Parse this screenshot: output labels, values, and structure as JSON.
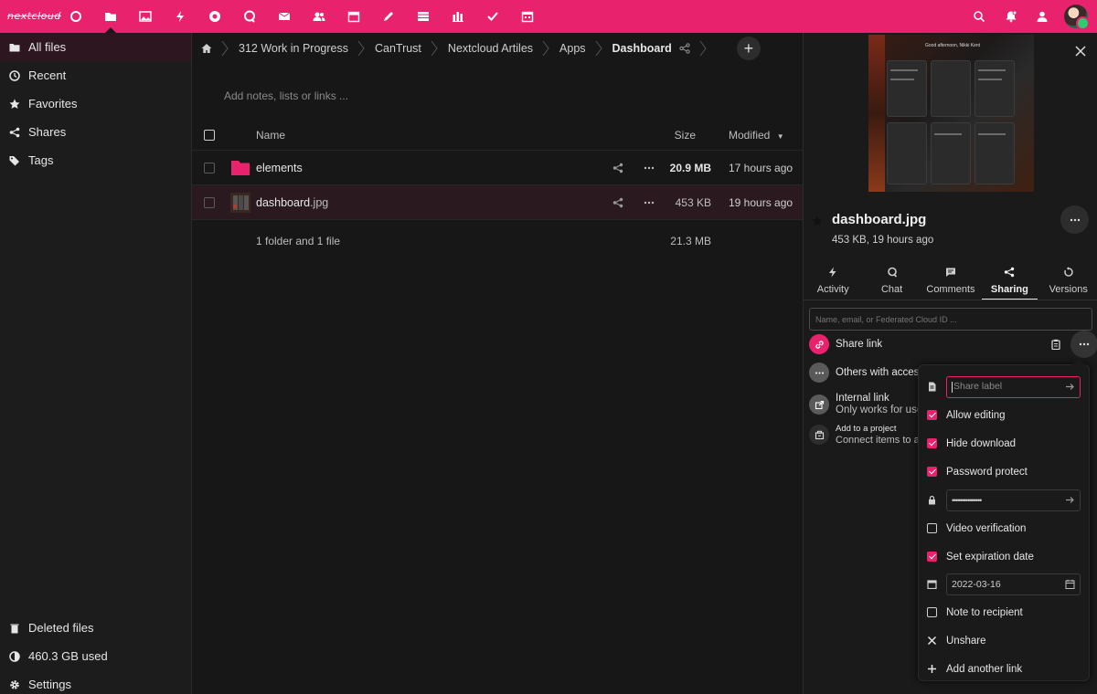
{
  "topbar": {
    "logo": "nextcloud",
    "apps": [
      "dashboard-icon",
      "files-icon",
      "photos-icon",
      "activity-icon",
      "circles-icon",
      "talk-icon",
      "mail-icon",
      "contacts-icon",
      "calendar-icon",
      "notes-icon",
      "deck-icon",
      "analytics-icon",
      "tasks-icon",
      "calendar-alt-icon"
    ],
    "right_icons": [
      "search-icon",
      "notifications-icon",
      "contacts-menu-icon"
    ]
  },
  "sidebar": {
    "items": [
      {
        "label": "All files",
        "icon": "folder-icon"
      },
      {
        "label": "Recent",
        "icon": "clock-icon"
      },
      {
        "label": "Favorites",
        "icon": "star-icon"
      },
      {
        "label": "Shares",
        "icon": "share-icon"
      },
      {
        "label": "Tags",
        "icon": "tag-icon"
      }
    ],
    "bottom": [
      {
        "label": "Deleted files",
        "icon": "trash-icon"
      },
      {
        "label": "460.3 GB used",
        "icon": "quota-icon"
      },
      {
        "label": "Settings",
        "icon": "gear-icon"
      }
    ]
  },
  "breadcrumb": [
    "312 Work in Progress",
    "CanTrust",
    "Nextcloud Artiles",
    "Apps",
    "Dashboard"
  ],
  "notes_placeholder": "Add notes, lists or links ...",
  "table": {
    "headers": {
      "name": "Name",
      "size": "Size",
      "modified": "Modified"
    },
    "rows": [
      {
        "name": "elements",
        "ext": "",
        "size": "20.9 MB",
        "modified": "17 hours ago"
      },
      {
        "name": "dashboard",
        "ext": ".jpg",
        "size": "453 KB",
        "modified": "19 hours ago"
      }
    ],
    "summary": {
      "label": "1 folder and 1 file",
      "size": "21.3 MB"
    }
  },
  "details": {
    "filename": "dashboard.jpg",
    "meta": "453 KB, 19 hours ago",
    "preview_greeting": "Good afternoon, Nikki Kent",
    "tabs": [
      "Activity",
      "Chat",
      "Comments",
      "Sharing",
      "Versions"
    ],
    "active_tab": "Sharing",
    "share_input_placeholder": "Name, email, or Federated Cloud ID ...",
    "share_link": "Share link",
    "others_with_access": "Others with access",
    "internal_link": "Internal link",
    "internal_link_sub": "Only works for users",
    "add_project": "Add to a project",
    "add_project_sub": "Connect items to a project"
  },
  "popover": {
    "share_label_placeholder": "Share label",
    "allow_editing": "Allow editing",
    "hide_download": "Hide download",
    "password_protect": "Password protect",
    "password_value": "•••••••••••••••",
    "video_verification": "Video verification",
    "set_expiration": "Set expiration date",
    "expiration_date": "2022-03-16",
    "note_to_recipient": "Note to recipient",
    "unshare": "Unshare",
    "add_another_link": "Add another link"
  },
  "colors": {
    "accent": "#e9226d",
    "background": "#171717"
  }
}
